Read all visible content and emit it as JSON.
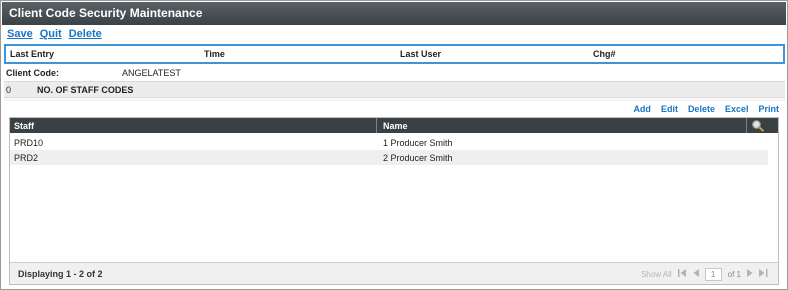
{
  "window": {
    "title": "Client Code Security Maintenance"
  },
  "toolbar": {
    "save": "Save",
    "quit": "Quit",
    "delete": "Delete"
  },
  "audit": {
    "last_entry": "Last Entry",
    "time": "Time",
    "last_user": "Last User",
    "chg": "Chg#"
  },
  "client": {
    "label": "Client Code:",
    "value": "ANGELATEST"
  },
  "staff_codes": {
    "count": "0",
    "label": "NO. OF STAFF CODES"
  },
  "grid_actions": {
    "add": "Add",
    "edit": "Edit",
    "delete": "Delete",
    "excel": "Excel",
    "print": "Print"
  },
  "grid": {
    "columns": {
      "staff": "Staff",
      "name": "Name"
    },
    "rows": [
      {
        "staff": "PRD10",
        "name": "1 Producer Smith"
      },
      {
        "staff": "PRD2",
        "name": "2 Producer Smith"
      }
    ],
    "footer": {
      "displaying": "Displaying 1 - 2 of 2",
      "show_all": "Show All",
      "page": "1",
      "of": "of 1"
    }
  },
  "colors": {
    "accent": "#1a74c4",
    "title_bar": "#3f464a",
    "grid_header": "#3a4144",
    "audit_border": "#3f94d8"
  },
  "icons": [
    "search-icon",
    "first-page-icon",
    "prev-page-icon",
    "next-page-icon",
    "last-page-icon"
  ]
}
